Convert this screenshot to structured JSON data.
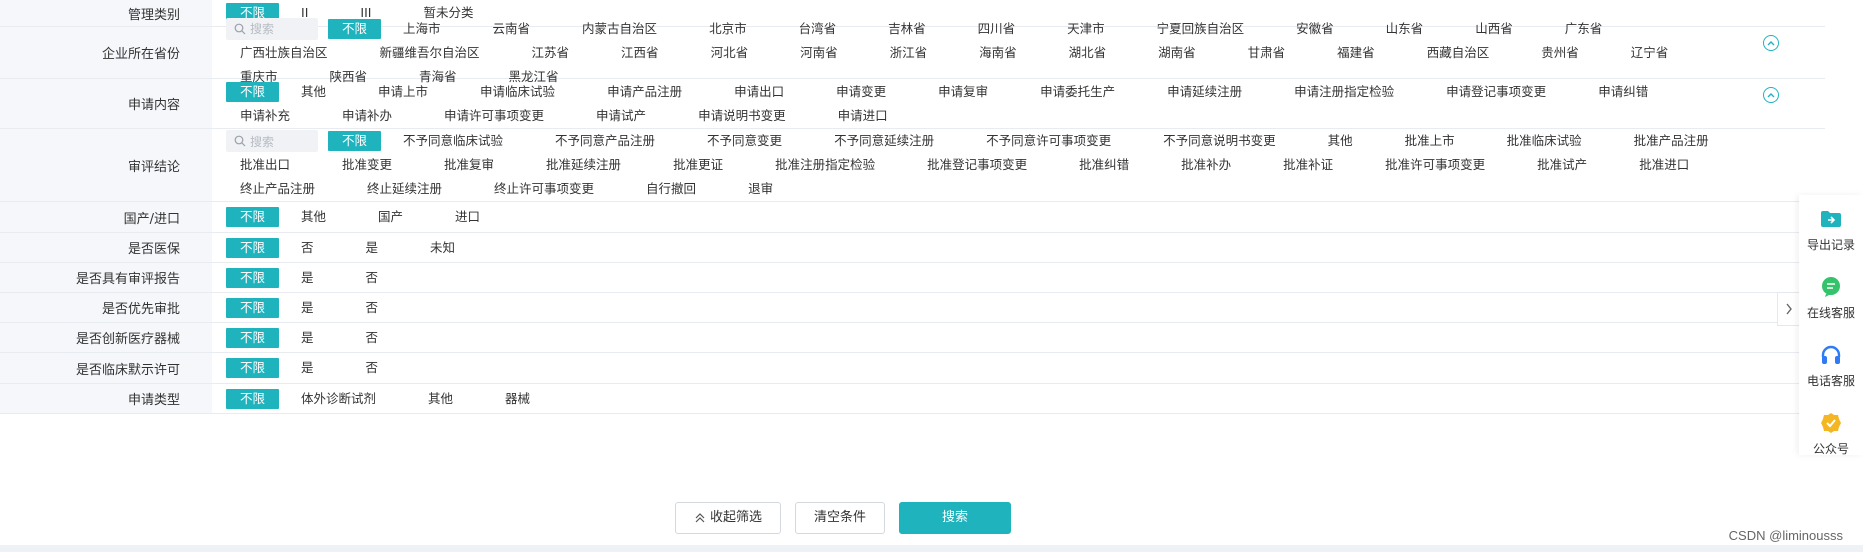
{
  "rows": [
    {
      "label": "管理类别",
      "options": [
        "不限",
        "II",
        "III",
        "暂未分类"
      ]
    },
    {
      "label": "企业所在省份",
      "search_placeholder": "搜索",
      "options": [
        "不限",
        "上海市",
        "云南省",
        "内蒙古自治区",
        "北京市",
        "台湾省",
        "吉林省",
        "四川省",
        "天津市",
        "宁夏回族自治区",
        "安徽省",
        "山东省",
        "山西省",
        "广东省",
        "广西壮族自治区",
        "新疆维吾尔自治区",
        "江苏省",
        "江西省",
        "河北省",
        "河南省",
        "浙江省",
        "海南省",
        "湖北省",
        "湖南省",
        "甘肃省",
        "福建省",
        "西藏自治区",
        "贵州省",
        "辽宁省",
        "重庆市",
        "陕西省",
        "青海省",
        "黑龙江省"
      ]
    },
    {
      "label": "申请内容",
      "options": [
        "不限",
        "其他",
        "申请上市",
        "申请临床试验",
        "申请产品注册",
        "申请出口",
        "申请变更",
        "申请复审",
        "申请委托生产",
        "申请延续注册",
        "申请注册指定检验",
        "申请登记事项变更",
        "申请纠错",
        "申请补充",
        "申请补办",
        "申请许可事项变更",
        "申请试产",
        "申请说明书变更",
        "申请进口"
      ]
    },
    {
      "label": "审评结论",
      "search_placeholder": "搜索",
      "options": [
        "不限",
        "不予同意临床试验",
        "不予同意产品注册",
        "不予同意变更",
        "不予同意延续注册",
        "不予同意许可事项变更",
        "不予同意说明书变更",
        "其他",
        "批准上市",
        "批准临床试验",
        "批准产品注册",
        "批准出口",
        "批准变更",
        "批准复审",
        "批准延续注册",
        "批准更证",
        "批准注册指定检验",
        "批准登记事项变更",
        "批准纠错",
        "批准补办",
        "批准补证",
        "批准许可事项变更",
        "批准试产",
        "批准进口",
        "终止产品注册",
        "终止延续注册",
        "终止许可事项变更",
        "自行撤回",
        "退审"
      ]
    },
    {
      "label": "国产/进口",
      "options": [
        "不限",
        "其他",
        "国产",
        "进口"
      ]
    },
    {
      "label": "是否医保",
      "options": [
        "不限",
        "否",
        "是",
        "未知"
      ]
    },
    {
      "label": "是否具有审评报告",
      "options": [
        "不限",
        "是",
        "否"
      ]
    },
    {
      "label": "是否优先审批",
      "options": [
        "不限",
        "是",
        "否"
      ]
    },
    {
      "label": "是否创新医疗器械",
      "options": [
        "不限",
        "是",
        "否"
      ]
    },
    {
      "label": "是否临床默示许可",
      "options": [
        "不限",
        "是",
        "否"
      ]
    },
    {
      "label": "申请类型",
      "options": [
        "不限",
        "体外诊断试剂",
        "其他",
        "器械"
      ]
    }
  ],
  "actions": {
    "collapse": "收起筛选",
    "clear": "清空条件",
    "search": "搜索"
  },
  "side_panel": [
    {
      "label": "导出记录",
      "icon": "export-folder-icon",
      "color": "#1fb3be"
    },
    {
      "label": "在线客服",
      "icon": "chat-bubble-icon",
      "color": "#34c26b"
    },
    {
      "label": "电话客服",
      "icon": "headset-icon",
      "color": "#2f7bf5"
    },
    {
      "label": "公众号",
      "icon": "badge-check-icon",
      "color": "#f5b623"
    }
  ],
  "watermark": "CSDN @liminousss",
  "colors": {
    "accent": "#1fb3be",
    "label_bg": "#f5f7fa"
  }
}
